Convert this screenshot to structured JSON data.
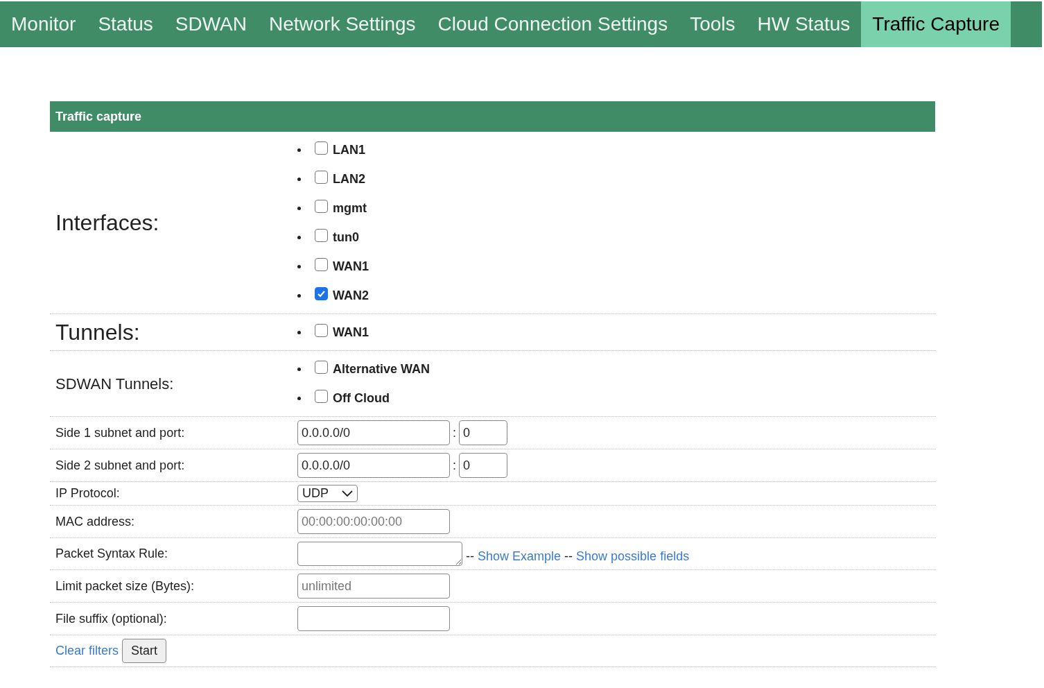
{
  "nav": [
    {
      "label": "Monitor",
      "selected": false
    },
    {
      "label": "Status",
      "selected": false
    },
    {
      "label": "SDWAN",
      "selected": false
    },
    {
      "label": "Network Settings",
      "selected": false
    },
    {
      "label": "Cloud Connection Settings",
      "selected": false
    },
    {
      "label": "Tools",
      "selected": false
    },
    {
      "label": "HW Status",
      "selected": false
    },
    {
      "label": "Traffic Capture",
      "selected": true
    }
  ],
  "panel": {
    "title": "Traffic capture"
  },
  "groups": [
    {
      "label": "Interfaces:",
      "kind": "large",
      "items": [
        {
          "label": "LAN1",
          "checked": false
        },
        {
          "label": "LAN2",
          "checked": false
        },
        {
          "label": "mgmt",
          "checked": false
        },
        {
          "label": "tun0",
          "checked": false
        },
        {
          "label": "WAN1",
          "checked": false
        },
        {
          "label": "WAN2",
          "checked": true
        }
      ]
    },
    {
      "label": "Tunnels:",
      "kind": "large",
      "items": [
        {
          "label": "WAN1",
          "checked": false
        }
      ]
    },
    {
      "label": "SDWAN Tunnels:",
      "kind": "medium",
      "items": [
        {
          "label": "Alternative WAN",
          "checked": false
        },
        {
          "label": "Off Cloud",
          "checked": false
        }
      ]
    }
  ],
  "fields": [
    {
      "kind": "subnet_port",
      "label": "Side 1 subnet and port:",
      "subnet": "0.0.0.0/0",
      "separator": ":",
      "port": "0"
    },
    {
      "kind": "subnet_port",
      "label": "Side 2 subnet and port:",
      "subnet": "0.0.0.0/0",
      "separator": ":",
      "port": "0"
    },
    {
      "kind": "select",
      "label": "IP Protocol:",
      "value": "UDP"
    },
    {
      "kind": "text",
      "label": "MAC address:",
      "placeholder": "00:00:00:00:00:00"
    },
    {
      "kind": "textarea",
      "label": "Packet Syntax Rule:",
      "links": [
        {
          "dash": "--",
          "label": "Show Example"
        },
        {
          "dash": "--",
          "label": "Show possible fields"
        }
      ]
    },
    {
      "kind": "text",
      "label": "Limit packet size (Bytes):",
      "placeholder": "unlimited"
    },
    {
      "kind": "text",
      "label": "File suffix (optional):"
    }
  ],
  "actions": {
    "link": "Clear filters",
    "button": "Start"
  }
}
